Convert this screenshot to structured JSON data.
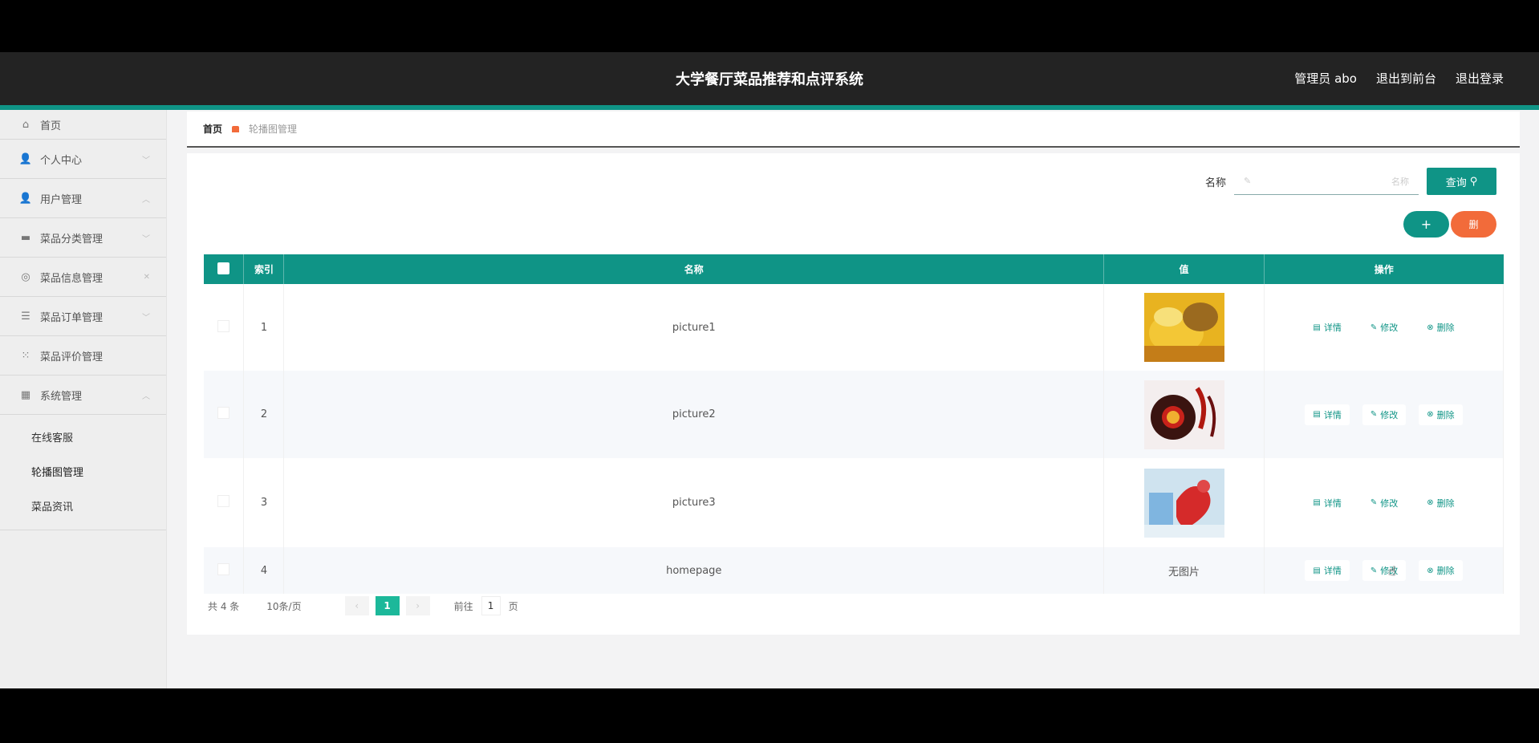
{
  "header": {
    "title": "大学餐厅菜品推荐和点评系统",
    "user": "管理员 abo",
    "to_front": "退出到前台",
    "logout": "退出登录"
  },
  "sidebar": {
    "items": [
      {
        "label": "首页",
        "icon": "home-icon"
      },
      {
        "label": "个人中心",
        "icon": "person-icon"
      },
      {
        "label": "用户管理",
        "icon": "user-icon"
      },
      {
        "label": "菜品分类管理",
        "icon": "category-icon"
      },
      {
        "label": "菜品信息管理",
        "icon": "info-icon"
      },
      {
        "label": "菜品订单管理",
        "icon": "list-icon"
      },
      {
        "label": "菜品评价管理",
        "icon": "grid-icon"
      },
      {
        "label": "系统管理",
        "icon": "system-icon"
      }
    ],
    "submenu": [
      "在线客服",
      "轮播图管理",
      "菜品资讯"
    ]
  },
  "breadcrumb": {
    "home": "首页",
    "current": "轮播图管理"
  },
  "search": {
    "label": "名称",
    "placeholder": "名称",
    "button": "查询"
  },
  "actions": {
    "add": "+",
    "delete": "删"
  },
  "table": {
    "headers": [
      "索引",
      "名称",
      "值",
      "操作"
    ],
    "rows": [
      {
        "index": "1",
        "name": "picture1",
        "value": "",
        "image": "yellow-dish"
      },
      {
        "index": "2",
        "name": "picture2",
        "value": "",
        "image": "red-dish"
      },
      {
        "index": "3",
        "name": "picture3",
        "value": "",
        "image": "blue-dish"
      },
      {
        "index": "4",
        "name": "homepage",
        "value": "无图片",
        "image": ""
      }
    ],
    "ops": {
      "detail": "详情",
      "edit": "修改",
      "remove": "删除"
    }
  },
  "pager": {
    "total": "共 4 条",
    "page_size": "10条/页",
    "current": "1",
    "goto_label": "前往",
    "goto_value": "1",
    "page_unit": "页"
  },
  "colors": {
    "accent": "#0f9486",
    "danger": "#f26b3a",
    "header_bg": "#232323"
  }
}
